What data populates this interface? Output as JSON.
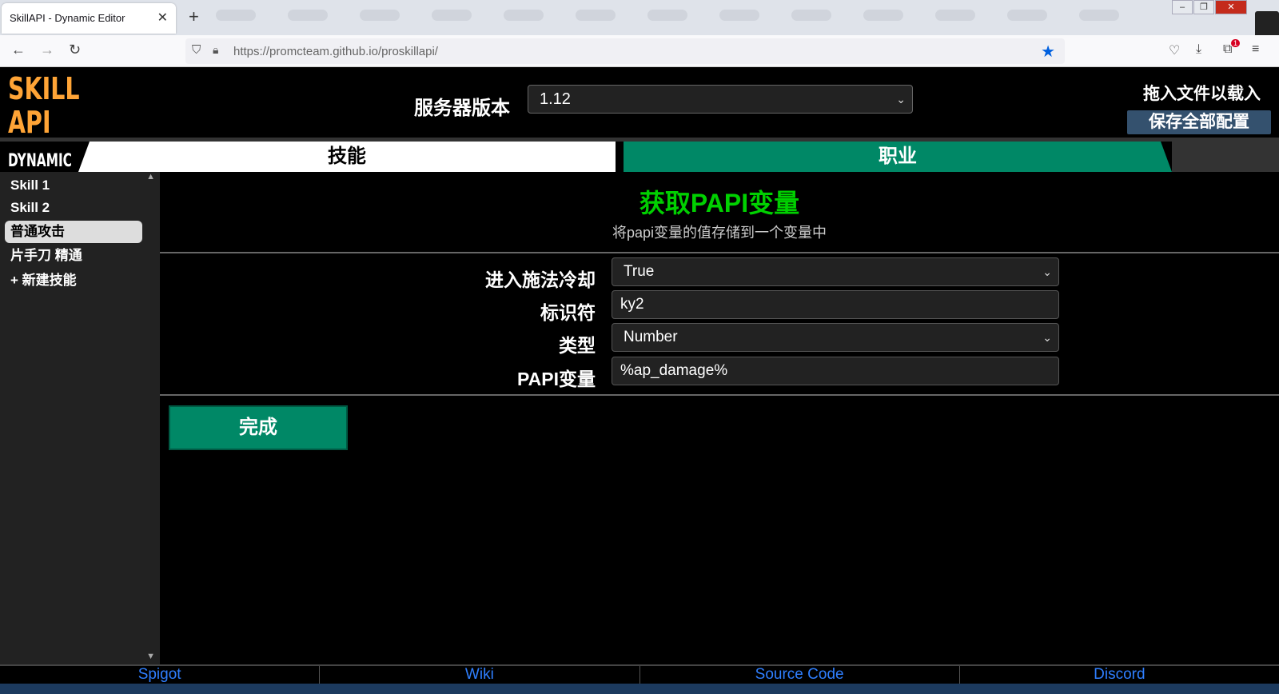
{
  "browser": {
    "tab_title": "SkillAPI - Dynamic Editor",
    "close_tab": "✕",
    "new_tab": "+",
    "url_host": "https://promcteam.github.io",
    "url_path": "/proskillapi/"
  },
  "header": {
    "logo_line1": "SKILL",
    "logo_line2": "API",
    "logo_line3": "DYNAMIC",
    "server_version_label": "服务器版本",
    "server_version_value": "1.12",
    "drop_file_label": "拖入文件以载入",
    "save_all_label": "保存全部配置"
  },
  "tabs": {
    "skill": "技能",
    "class": "职业"
  },
  "sidebar": {
    "items": [
      {
        "label": "Skill 1"
      },
      {
        "label": "Skill 2"
      },
      {
        "label": "普通攻击"
      },
      {
        "label": "片手刀 精通"
      },
      {
        "label": "+ 新建技能"
      }
    ]
  },
  "main": {
    "title": "获取PAPI变量",
    "description": "将papi变量的值存储到一个变量中",
    "fields": [
      {
        "label": "进入施法冷却",
        "value": "True"
      },
      {
        "label": "标识符",
        "value": "ky2"
      },
      {
        "label": "类型",
        "value": "Number"
      },
      {
        "label": "PAPI变量",
        "value": "%ap_damage%"
      }
    ],
    "done_label": "完成"
  },
  "footer": {
    "links": [
      "Spigot",
      "Wiki",
      "Source Code",
      "Discord"
    ]
  },
  "colors": {
    "logo": "#ffa436",
    "title_green": "#00d000",
    "accent_teal": "#008866",
    "save_button": "#34516e",
    "link_blue": "#2f7fff"
  }
}
